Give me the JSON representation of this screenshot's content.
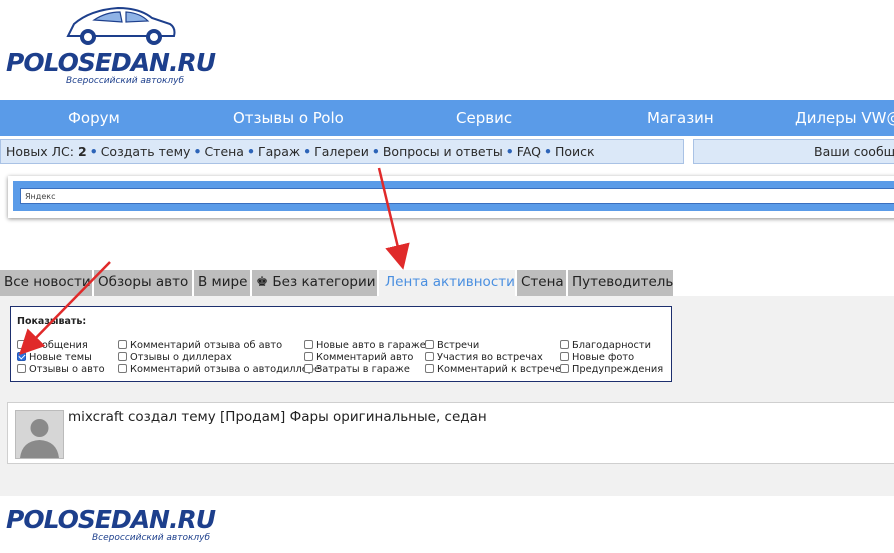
{
  "logo": {
    "brand": "POLOSEDAN.RU",
    "subtitle": "Всероссийский автоклуб"
  },
  "nav": {
    "items": [
      "Форум",
      "Отзывы о Polo",
      "Сервис",
      "Магазин",
      "Дилеры VW@"
    ]
  },
  "subbar": {
    "pm_label": "Новых ЛС:",
    "pm_count": "2",
    "links": [
      "Создать тему",
      "Стена",
      "Гараж",
      "Галереи",
      "Вопросы и ответы",
      "FAQ",
      "Поиск"
    ]
  },
  "messages": {
    "label": "Ваши сообще"
  },
  "search": {
    "placeholder": "Яндекс"
  },
  "tabs": [
    {
      "label": "Все новости"
    },
    {
      "label": "Обзоры авто"
    },
    {
      "label": "В мире"
    },
    {
      "label": "Без категории",
      "icon": "crown-icon"
    },
    {
      "label": "Лента активности"
    },
    {
      "label": "Стена"
    },
    {
      "label": "Путеводитель"
    }
  ],
  "filters": {
    "title": "Показывать:",
    "options": [
      {
        "label": "Сообщения",
        "checked": false
      },
      {
        "label": "Новые темы",
        "checked": true
      },
      {
        "label": "Отзывы о авто",
        "checked": false
      },
      {
        "label": "Комментарий отзыва об авто",
        "checked": false
      },
      {
        "label": "Отзывы о диллерах",
        "checked": false
      },
      {
        "label": "Комментарий отзыва о автодиллере",
        "checked": false
      },
      {
        "label": "Новые авто в гараже",
        "checked": false
      },
      {
        "label": "Комментарий авто",
        "checked": false
      },
      {
        "label": "Затраты в гараже",
        "checked": false
      },
      {
        "label": "Встречи",
        "checked": false
      },
      {
        "label": "Участия во встречах",
        "checked": false
      },
      {
        "label": "Комментарий к встрече",
        "checked": false
      },
      {
        "label": "Благодарности",
        "checked": false
      },
      {
        "label": "Новые фото",
        "checked": false
      },
      {
        "label": "Предупреждения",
        "checked": false
      }
    ]
  },
  "feed": {
    "items": [
      {
        "text": "mixcraft создал тему [Продам] Фары оригинальные, седан"
      }
    ]
  },
  "colors": {
    "nav": "#5a9be8",
    "brand": "#1d3f8c",
    "active_tab": "#4a8fe0",
    "arrow": "#e02a2a"
  }
}
